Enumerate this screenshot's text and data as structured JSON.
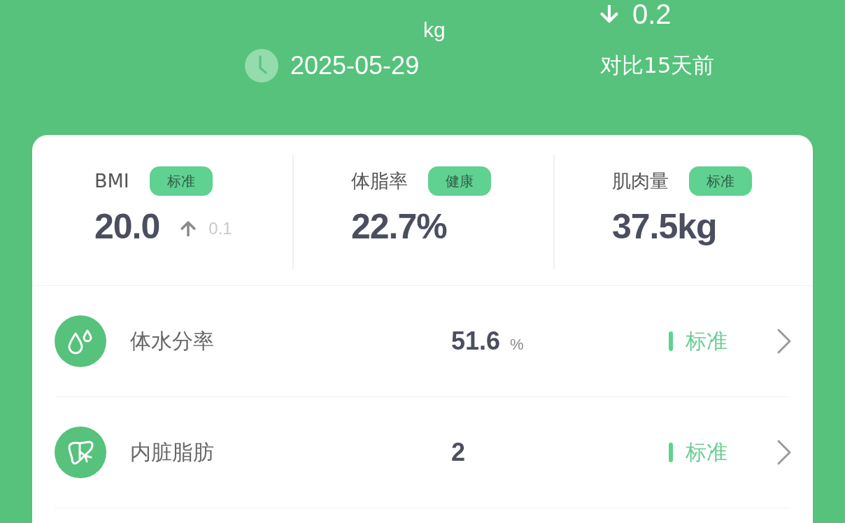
{
  "weight": {
    "unit": "kg",
    "date": "2025-05-29"
  },
  "change": {
    "rising": false,
    "value": "0.2",
    "caption": "对比15天前"
  },
  "summary": [
    {
      "label": "BMI",
      "badge": "标准",
      "value": "20.0",
      "delta": {
        "rising": true,
        "value": "0.1"
      }
    },
    {
      "label": "体脂率",
      "badge": "健康",
      "value": "22.7%"
    },
    {
      "label": "肌肉量",
      "badge": "标准",
      "value": "37.5kg"
    }
  ],
  "metrics": [
    {
      "kind": "water",
      "name": "体水分率",
      "value": "51.6",
      "unit": "%",
      "status": "标准"
    },
    {
      "kind": "organ",
      "name": "内脏脂肪",
      "value": "2",
      "status": "标准"
    }
  ]
}
